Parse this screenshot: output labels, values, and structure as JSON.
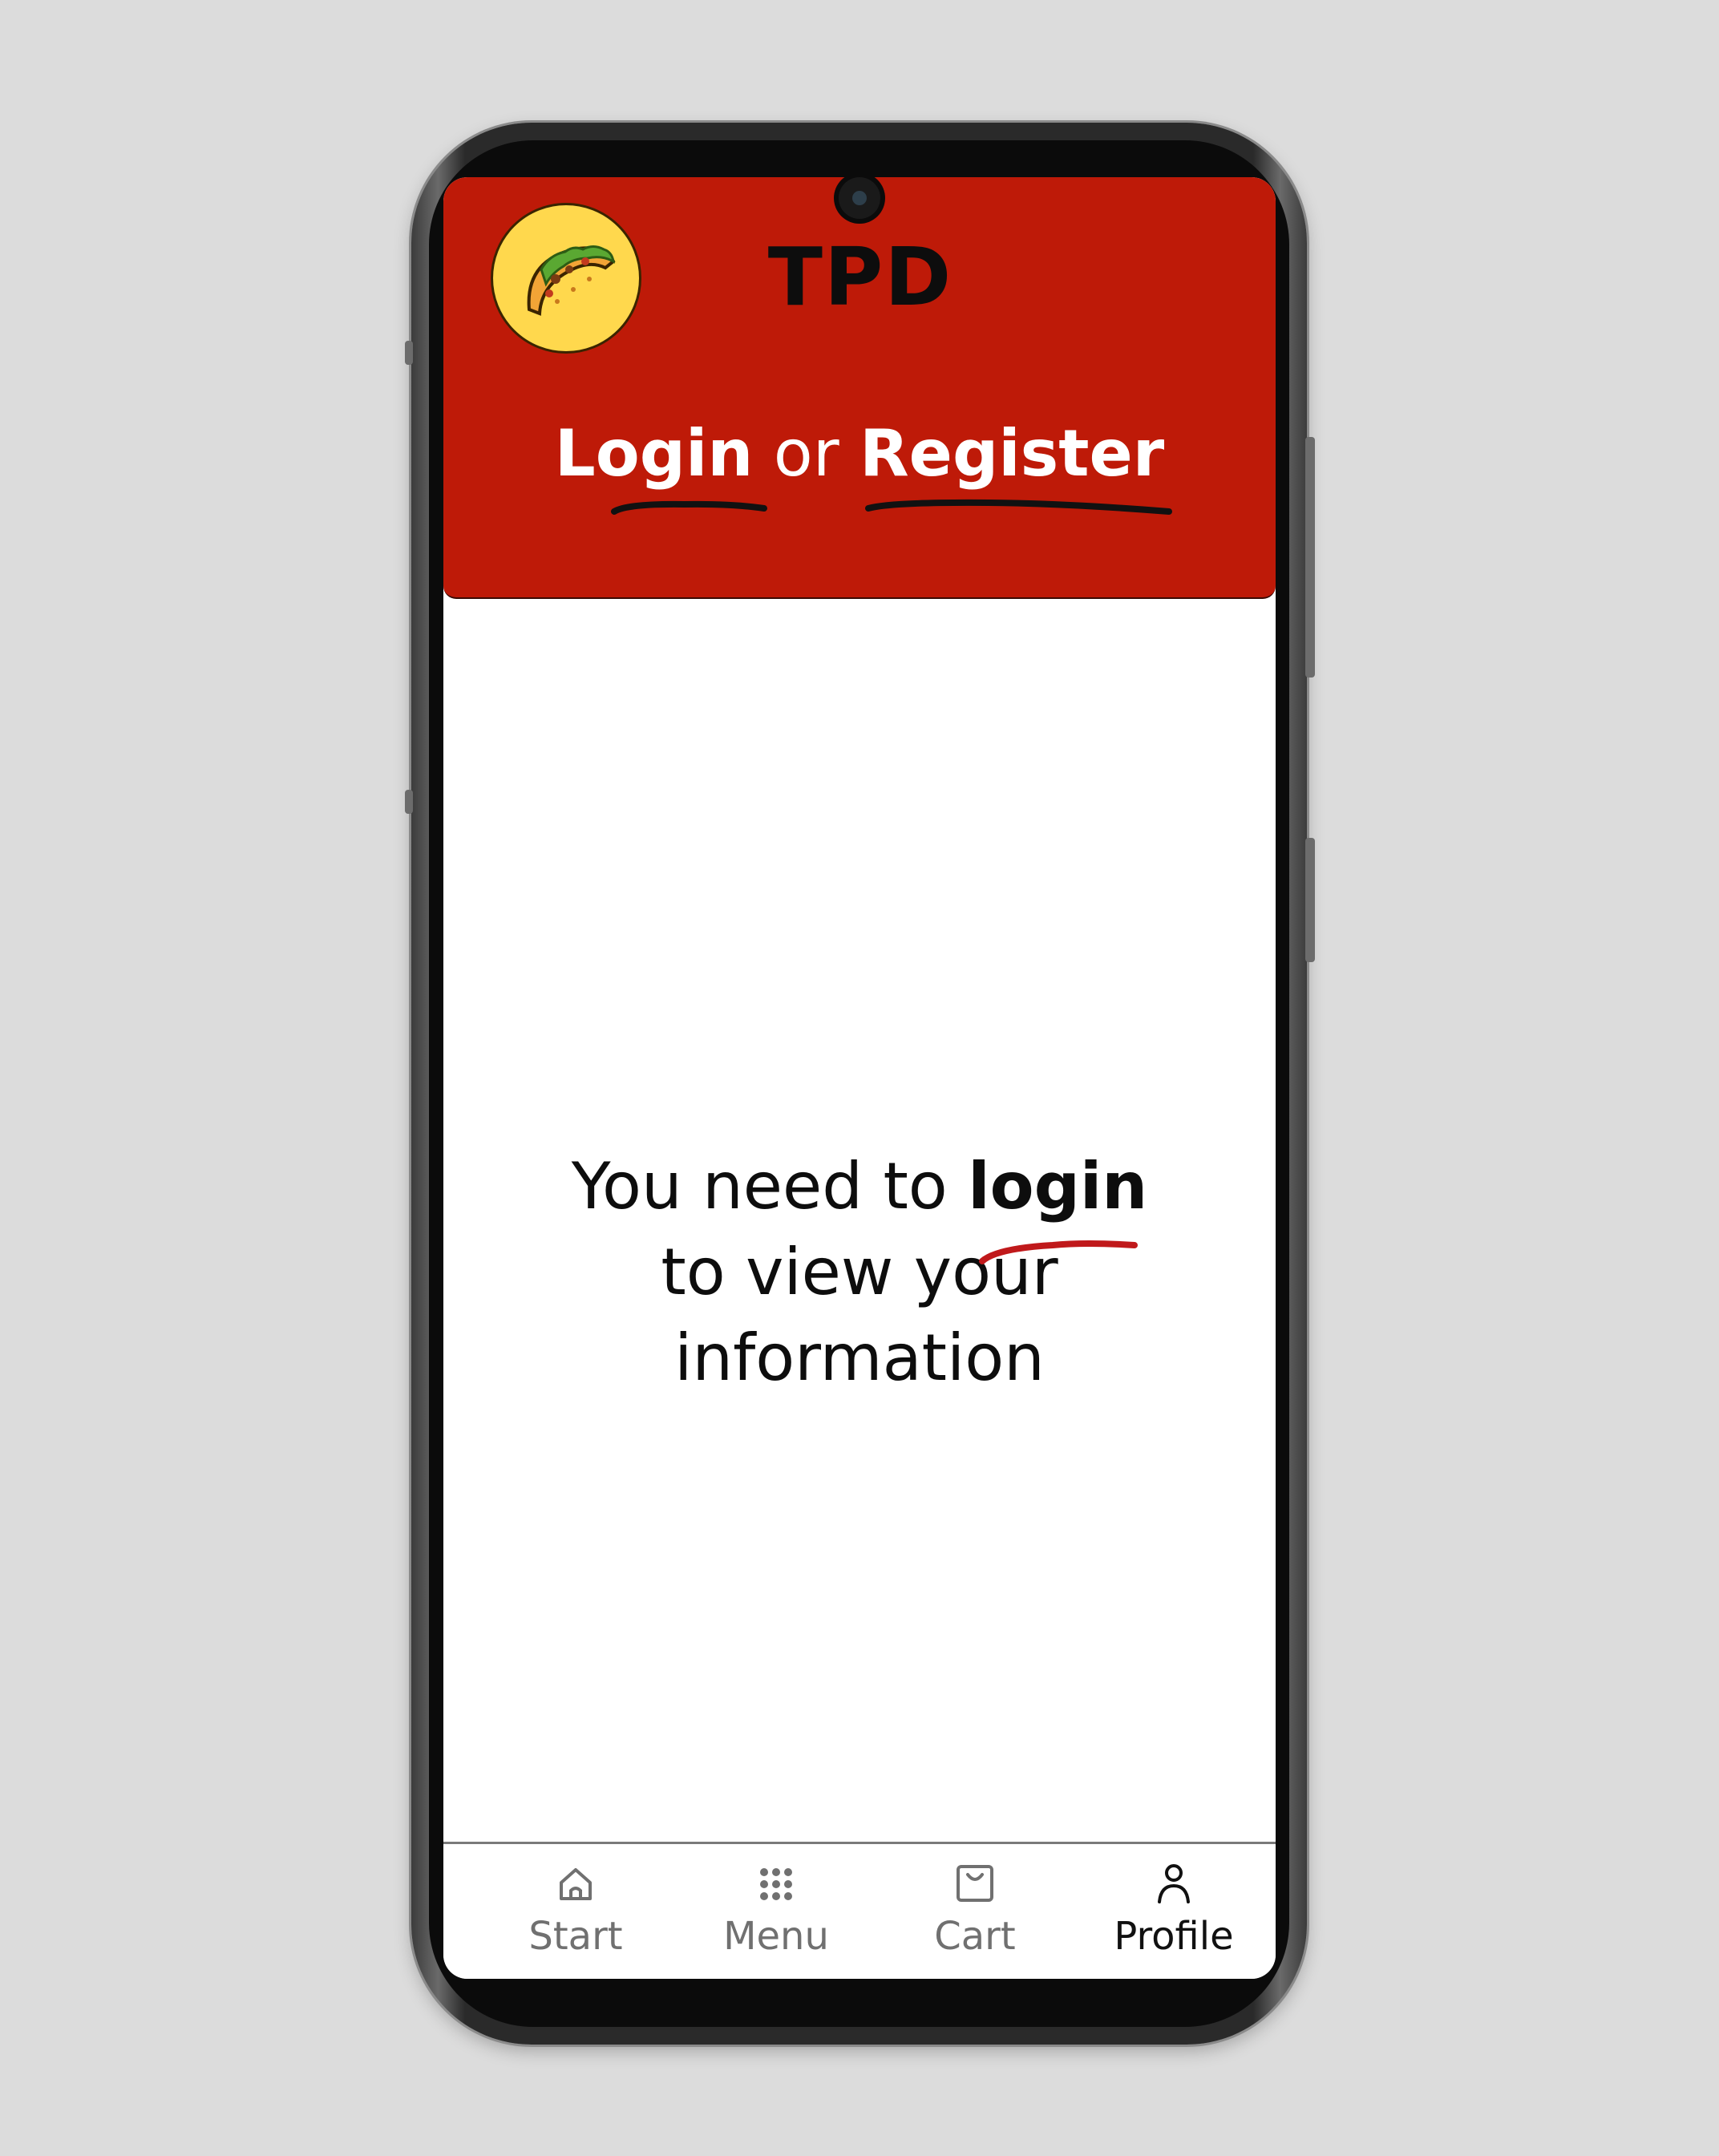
{
  "header": {
    "brand": "TPD",
    "auth_login": "Login",
    "auth_or": "or",
    "auth_register": "Register"
  },
  "main": {
    "message_part1": "You need to ",
    "message_bold": "login",
    "message_part2": "to view your",
    "message_part3": "information"
  },
  "nav": {
    "items": [
      {
        "label": "Start",
        "icon": "home-icon"
      },
      {
        "label": "Menu",
        "icon": "grid-dots-icon"
      },
      {
        "label": "Cart",
        "icon": "bag-icon"
      },
      {
        "label": "Profile",
        "icon": "user-icon"
      }
    ],
    "active": "Profile"
  },
  "colors": {
    "header_bg": "#be1a08",
    "logo_bg": "#ffd84d",
    "underline_dark": "#111111",
    "underline_red": "#c0191b",
    "nav_inactive": "#707070",
    "nav_active": "#111111"
  }
}
